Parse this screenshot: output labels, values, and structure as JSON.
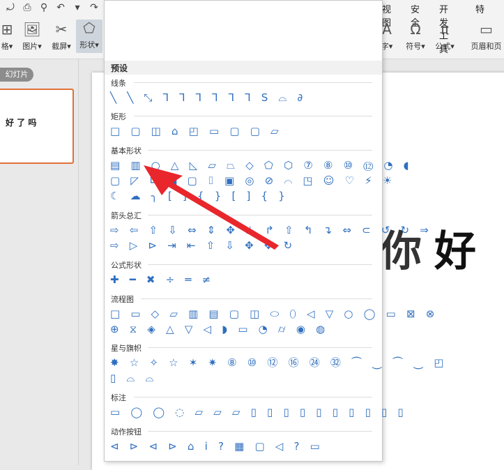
{
  "ribbon": {
    "quick_access": [
      "⤾",
      "⎙",
      "⚲",
      "↶",
      "▾",
      "↷",
      "⌂"
    ],
    "tabs": [
      "视图",
      "安全",
      "开发工具",
      "特"
    ],
    "left_buttons": [
      {
        "icon": "⊞",
        "label": "格▾"
      },
      {
        "icon": "🖼",
        "label": "图片▾"
      },
      {
        "icon": "✂",
        "label": "截屏▾"
      },
      {
        "icon": "⬠",
        "label": "形状▾"
      }
    ],
    "right_buttons": [
      {
        "icon": "A",
        "label": "字▾"
      },
      {
        "icon": "Ω",
        "label": "符号▾"
      },
      {
        "icon": "π",
        "label": "公式▾"
      },
      {
        "icon": "▭",
        "label": "页眉和页"
      }
    ]
  },
  "sidebar": {
    "pill_label": "幻灯片",
    "thumb_text": "好 了 吗"
  },
  "slide": {
    "text": "好"
  },
  "slide_partial": "你",
  "shapes_menu": {
    "header": "预设",
    "categories": [
      {
        "title": "线条",
        "rows": [
          "╲ ╲ ⤡ ⅂ ⅂ ⅂ ⅂ ⅂ ⅂ S ⌓ ∂"
        ]
      },
      {
        "title": "矩形",
        "rows": [
          "□ ▢ ◫ ⌂ ◰ ▭ ▢ ▢ ▱"
        ]
      },
      {
        "title": "基本形状",
        "rows": [
          "▤ ▥ ○ △ ◺ ▱ ⏢ ◇ ⬠ ⬡ ⑦ ⑧ ⑩ ⑫ ◔ ◖",
          "▢ ◸ ∟ ◢ ▢ ⌷ ▣ ◎ ⊘ ⌒ ◳ ☺ ♡ ⚡ ☀",
          "☾ ☁ ╮ [ ] { } [ ] { }"
        ]
      },
      {
        "title": "箭头总汇",
        "rows": [
          "⇨ ⇦ ⇧ ⇩ ⇔ ⇕ ✥ ⊥ ↱ ⇧ ↰ ↴ ⇔ ⊂ ↺ ↻ ⇒",
          "⇨ ▷ ⊳ ⇥ ⇤ ⇧ ⇩ ✥ ✥ ↻"
        ]
      },
      {
        "title": "公式形状",
        "rows": [
          "✚ ━ ✖ ÷ ═ ≠"
        ]
      },
      {
        "title": "流程图",
        "rows": [
          "□ ▭ ◇ ▱ ▥ ▤ ▢ ◫ ⬭ ⬯ ◁ ▽ ○ ◯ ▭ ⊠ ⊗",
          "⊕ ⧖ ◈ △ ▽ ◁ ◗ ▭ ◔ ⌭ ◉ ◍"
        ]
      },
      {
        "title": "星与旗帜",
        "rows": [
          "✸ ☆ ✧ ☆ ✶ ✷ ⑧ ⑩ ⑫ ⑯ ㉔ ㉜ ⏜ ⏝ ⏜ ⏝ ◰",
          "▯ ⌓ ⌓"
        ]
      },
      {
        "title": "标注",
        "rows": [
          "▭ ◯ ◯ ◌ ▱ ▱ ▱ ▯ ▯ ▯ ▯ ▯ ▯ ▯ ▯ ▯ ▯"
        ]
      },
      {
        "title": "动作按钮",
        "rows": [
          "⊲ ⊳ ⊲ ⊳ ⌂ i ? ▦ ▢ ◁ ? ▭"
        ]
      }
    ]
  }
}
